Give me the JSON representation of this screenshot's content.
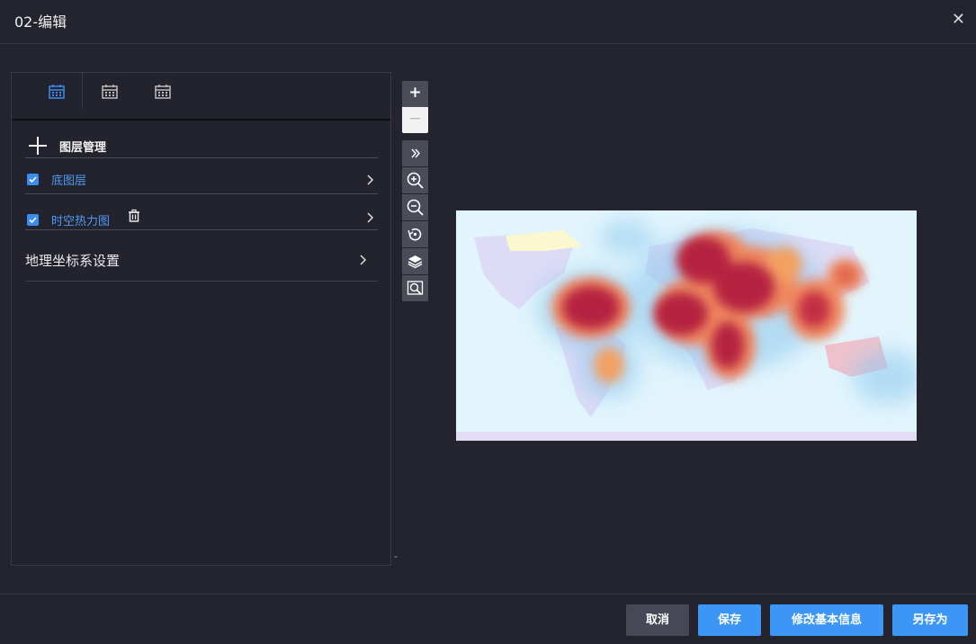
{
  "dialog": {
    "title": "02-编辑",
    "close_icon": "close-icon"
  },
  "tabs": [
    {
      "icon": "calendar-icon",
      "active": true,
      "color": "#3b8cf0"
    },
    {
      "icon": "calendar-icon",
      "active": false,
      "color": "#bdbdbd"
    },
    {
      "icon": "calendar-icon",
      "active": false,
      "color": "#bdbdbd"
    }
  ],
  "layer_panel": {
    "title": "图层管理",
    "add_icon": "plus-icon",
    "layers": [
      {
        "label": "底图层",
        "checked": true,
        "has_delete": false
      },
      {
        "label": "时空热力图",
        "checked": true,
        "has_delete": true
      }
    ],
    "geo_settings": "地理坐标系设置"
  },
  "panel_marker": "-",
  "map_tools": {
    "zoom_in": "+",
    "zoom_out": "−",
    "tools": [
      "expand-icon",
      "zoom-in-icon",
      "zoom-out-icon",
      "reset-icon",
      "layers-icon",
      "search-icon"
    ]
  },
  "footer": {
    "cancel": "取消",
    "save": "保存",
    "modify": "修改基本信息",
    "save_as": "另存为"
  },
  "colors": {
    "accent": "#3b96f5",
    "background": "#23242d",
    "heat_core": "#b5203f",
    "heat_edge": "#f5a06a",
    "map_ocean": "#e2f5fd"
  }
}
